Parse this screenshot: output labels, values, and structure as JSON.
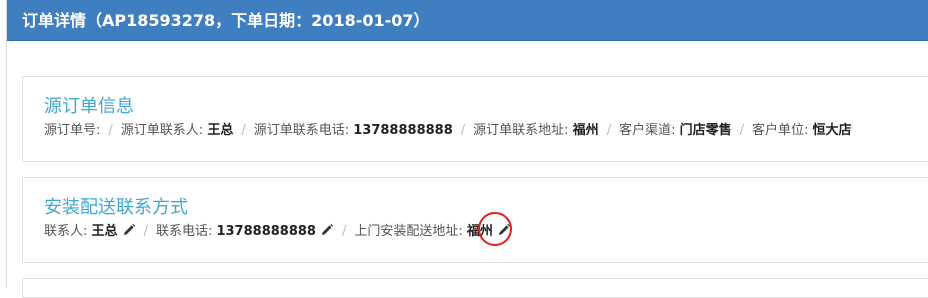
{
  "header": {
    "title": "订单详情（AP18593278，下单日期：2018-01-07）"
  },
  "source_order": {
    "title": "源订单信息",
    "fields": [
      {
        "label": "源订单号:",
        "value": ""
      },
      {
        "label": "源订单联系人:",
        "value": "王总"
      },
      {
        "label": "源订单联系电话:",
        "value": "13788888888"
      },
      {
        "label": "源订单联系地址:",
        "value": "福州"
      },
      {
        "label": "客户渠道:",
        "value": "门店零售"
      },
      {
        "label": "客户单位:",
        "value": "恒大店"
      }
    ],
    "separator": "/"
  },
  "install_contact": {
    "title": "安装配送联系方式",
    "fields": [
      {
        "label": "联系人:",
        "value": "王总",
        "edit_icon": "pencil-icon"
      },
      {
        "label": "联系电话:",
        "value": "13788888888",
        "edit_icon": "pencil-icon"
      },
      {
        "label": "上门安装配送地址:",
        "value": "福州",
        "edit_icon": "pencil-icon"
      }
    ],
    "separator": "/"
  },
  "colors": {
    "header_bg": "#3f7fc1",
    "section_title": "#3fa9d4",
    "highlight_circle": "#e0201b"
  }
}
